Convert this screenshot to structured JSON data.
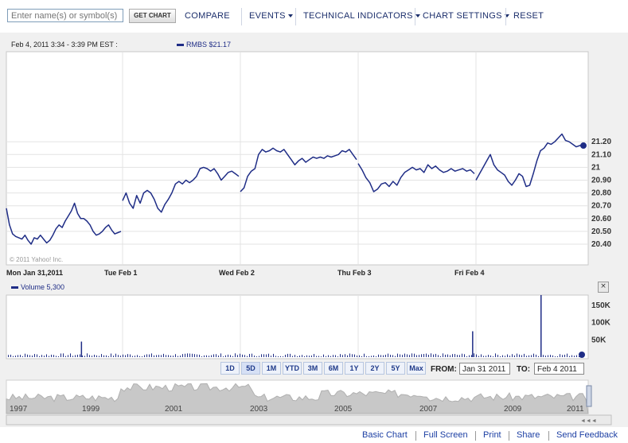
{
  "toolbar": {
    "search_placeholder": "Enter name(s) or symbol(s)",
    "get_chart": "GET CHART",
    "compare": "COMPARE",
    "events": "EVENTS",
    "technical_indicators": "TECHNICAL INDICATORS",
    "chart_settings": "CHART SETTINGS",
    "reset": "RESET"
  },
  "header": {
    "date_range": "Feb 4, 2011 3:34 - 3:39 PM EST :",
    "legend": "RMBS  $21.17"
  },
  "watermark": "© 2011 Yahoo! Inc.",
  "volume_legend": "Volume  5,300",
  "close_label": "×",
  "range_buttons": [
    "1D",
    "5D",
    "1M",
    "YTD",
    "3M",
    "6M",
    "1Y",
    "2Y",
    "5Y",
    "Max"
  ],
  "from_label": "FROM:",
  "from_value": "Jan 31 2011",
  "to_label": "TO:",
  "to_value": "Feb 4 2011",
  "footer": {
    "basic_chart": "Basic Chart",
    "full_screen": "Full Screen",
    "print": "Print",
    "share": "Share",
    "send_feedback": "Send Feedback"
  },
  "colors": {
    "line": "#1f2d86",
    "volume": "#1f2d86",
    "overview": "#c8c8c8"
  },
  "chart_data": {
    "type": "line",
    "ylim": [
      20.35,
      21.25
    ],
    "y_ticks": [
      "20.40",
      "20.50",
      "20.60",
      "20.70",
      "20.80",
      "20.90",
      "21",
      "21.10",
      "21.20"
    ],
    "x_labels": [
      "Mon Jan 31,2011",
      "Tue Feb 1",
      "Wed Feb 2",
      "Thu Feb 3",
      "Fri Feb 4"
    ],
    "series": [
      {
        "day": "Mon Jan 31",
        "values": [
          20.68,
          20.55,
          20.48,
          20.46,
          20.45,
          20.44,
          20.47,
          20.43,
          20.4,
          20.45,
          20.44,
          20.47,
          20.44,
          20.41,
          20.43,
          20.47,
          20.52,
          20.55,
          20.53,
          20.58,
          20.62,
          20.66,
          20.72,
          20.64,
          20.6,
          20.6,
          20.58,
          20.55,
          20.5,
          20.47,
          20.48,
          20.5,
          20.53,
          20.55,
          20.51,
          20.48,
          20.49,
          20.5
        ]
      },
      {
        "day": "Tue Feb 1",
        "values": [
          20.74,
          20.8,
          20.72,
          20.68,
          20.78,
          20.72,
          20.8,
          20.82,
          20.8,
          20.75,
          20.68,
          20.65,
          20.71,
          20.75,
          20.8,
          20.87,
          20.89,
          20.87,
          20.9,
          20.88,
          20.9,
          20.93,
          20.99,
          21.0,
          20.99,
          20.97,
          20.99,
          20.95,
          20.9,
          20.93,
          20.96,
          20.97,
          20.95,
          20.93
        ]
      },
      {
        "day": "Wed Feb 2",
        "values": [
          20.81,
          20.84,
          20.93,
          20.97,
          20.99,
          21.1,
          21.14,
          21.12,
          21.13,
          21.15,
          21.13,
          21.12,
          21.14,
          21.1,
          21.06,
          21.02,
          21.05,
          21.07,
          21.04,
          21.06,
          21.08,
          21.07,
          21.08,
          21.07,
          21.09,
          21.08,
          21.09,
          21.1,
          21.13,
          21.12,
          21.14,
          21.1,
          21.06
        ]
      },
      {
        "day": "Thu Feb 3",
        "values": [
          21.03,
          20.98,
          20.92,
          20.88,
          20.81,
          20.83,
          20.87,
          20.88,
          20.85,
          20.89,
          20.86,
          20.92,
          20.96,
          20.98,
          21.0,
          20.98,
          20.99,
          20.96,
          21.02,
          20.99,
          21.01,
          20.98,
          20.96,
          20.97,
          20.99,
          20.97,
          20.98,
          20.99,
          20.97,
          20.98,
          20.95
        ]
      },
      {
        "day": "Fri Feb 4",
        "values": [
          20.9,
          20.95,
          21.0,
          21.05,
          21.1,
          21.02,
          20.98,
          20.96,
          20.94,
          20.89,
          20.86,
          20.9,
          20.95,
          20.93,
          20.85,
          20.86,
          20.95,
          21.05,
          21.13,
          21.15,
          21.19,
          21.18,
          21.2,
          21.23,
          21.26,
          21.21,
          21.2,
          21.18,
          21.16,
          21.17,
          21.17
        ]
      }
    ],
    "volume_ticks": [
      "50K",
      "100K",
      "150K"
    ],
    "volume_ylim": [
      0,
      180000
    ],
    "volume_spikes": [
      {
        "day_index": 0,
        "position": 0.65,
        "value": 45000
      },
      {
        "day_index": 4,
        "position": 0.6,
        "value": 180000
      },
      {
        "day_index": 3,
        "position": 0.98,
        "value": 75000
      }
    ],
    "overview_years": [
      "1997",
      "1999",
      "2001",
      "2003",
      "2005",
      "2007",
      "2009",
      "2011"
    ]
  }
}
